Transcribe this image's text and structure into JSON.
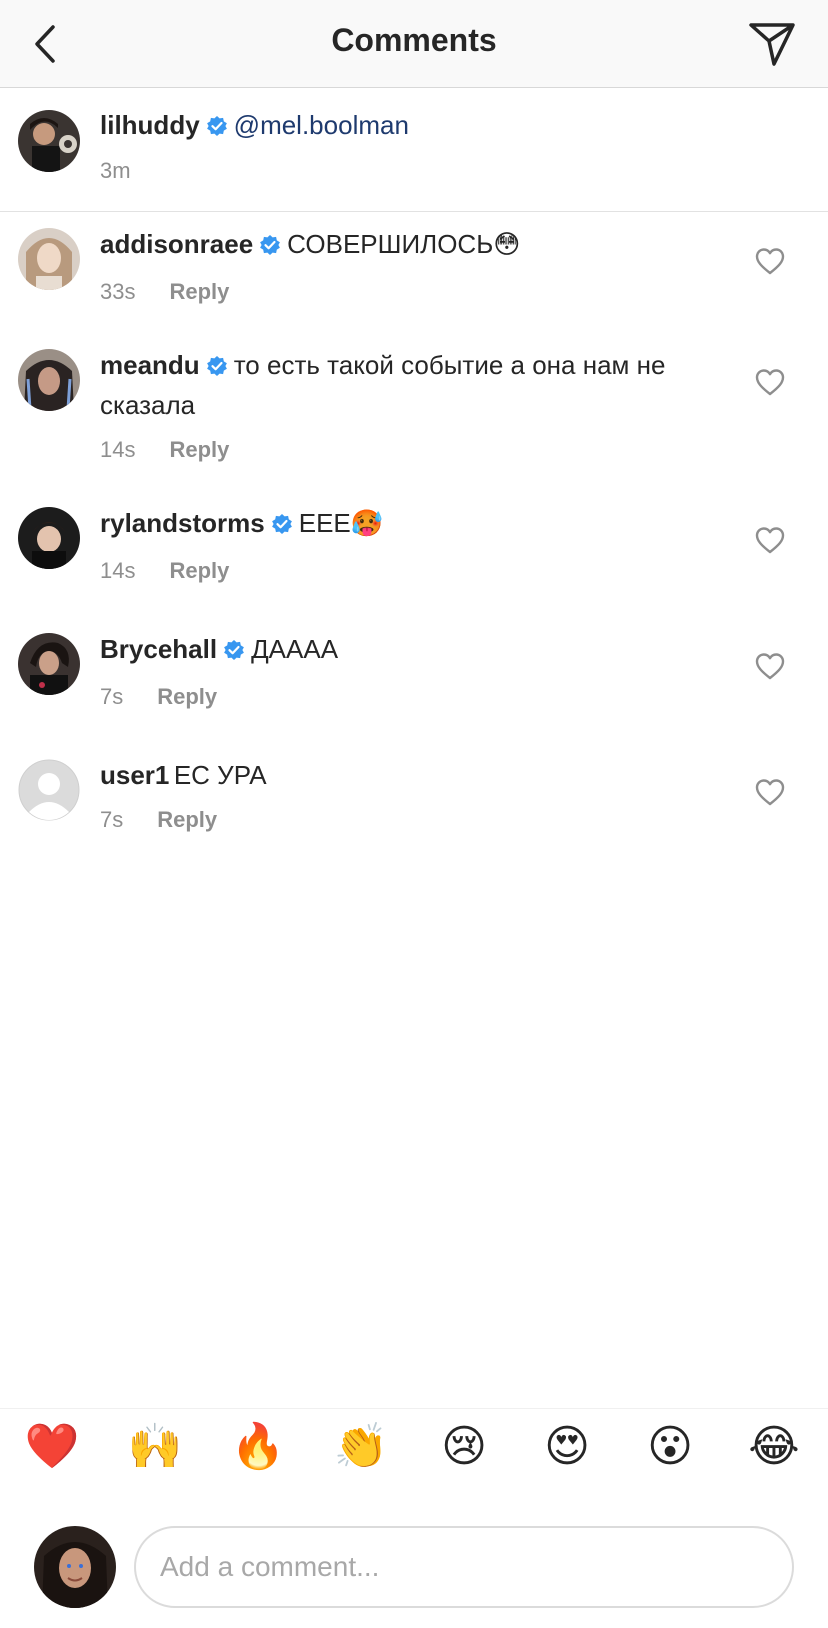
{
  "header": {
    "title": "Comments",
    "back_icon": "chevron-left-icon",
    "send_icon": "paper-plane-icon"
  },
  "caption": {
    "username": "lilhuddy",
    "mention": "@mel.boolman",
    "time": "3m"
  },
  "comments": [
    {
      "username": "addisonraee",
      "text": "СОВЕРШИЛОСЬ😳",
      "time": "33s",
      "reply": "Reply",
      "verified": true
    },
    {
      "username": "meandu",
      "text": "то есть такой событие  а она нам не сказала",
      "time": "14s",
      "reply": "Reply",
      "verified": true
    },
    {
      "username": "rylandstorms",
      "text": "ЕЕЕ🥵",
      "time": "14s",
      "reply": "Reply",
      "verified": true
    },
    {
      "username": "Brycehall",
      "text": "ДАААА",
      "time": "7s",
      "reply": "Reply",
      "verified": true
    },
    {
      "username": "user1",
      "text": "ЕС УРА",
      "time": "7s",
      "reply": "Reply",
      "verified": false
    }
  ],
  "emoji_bar": [
    "❤️",
    "🙌",
    "🔥",
    "👏",
    "😢",
    "😍",
    "😮",
    "😂"
  ],
  "composer": {
    "placeholder": "Add a comment..."
  },
  "colors": {
    "verified": "#3897f0",
    "link": "#1e3a6e",
    "muted": "#8e8e8e"
  }
}
